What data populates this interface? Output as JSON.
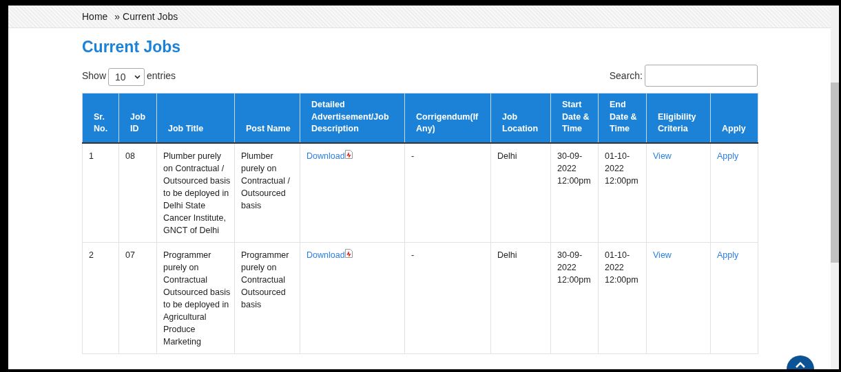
{
  "breadcrumb": [
    {
      "label": "Home"
    },
    {
      "label": "» Current Jobs"
    }
  ],
  "heading": "Current Jobs",
  "length_control": {
    "show_label": "Show",
    "value": "10",
    "entries_label": "entries"
  },
  "search": {
    "label": "Search:"
  },
  "table": {
    "columns": [
      "Sr. No.",
      "Job ID",
      "Job Title",
      "Post Name",
      "Detailed Advertisement/Job Description",
      "Corrigendum(If Any)",
      "Job Location",
      "Start Date & Time",
      "End Date & Time",
      "Eligibility Criteria",
      "Apply"
    ],
    "rows": [
      {
        "sr_no": "1",
        "job_id": "08",
        "job_title": "Plumber purely on Contractual / Outsourced basis to be deployed in Delhi State Cancer Institute, GNCT of Delhi",
        "post_name": "Plumber purely on Contractual / Outsourced basis",
        "advertisement": "Download",
        "corrigendum": "-",
        "location": "Delhi",
        "start": "30-09-2022 12:00pm",
        "end": "01-10-2022 12:00pm",
        "eligibility": "View",
        "apply": "Apply"
      },
      {
        "sr_no": "2",
        "job_id": "07",
        "job_title": "Programmer purely on Contractual Outsourced basis to be deployed in Agricultural Produce Marketing",
        "post_name": "Programmer purely on Contractual Outsourced basis",
        "advertisement": "Download",
        "corrigendum": "-",
        "location": "Delhi",
        "start": "30-09-2022 12:00pm",
        "end": "01-10-2022 12:00pm",
        "eligibility": "View",
        "apply": "Apply"
      }
    ]
  }
}
